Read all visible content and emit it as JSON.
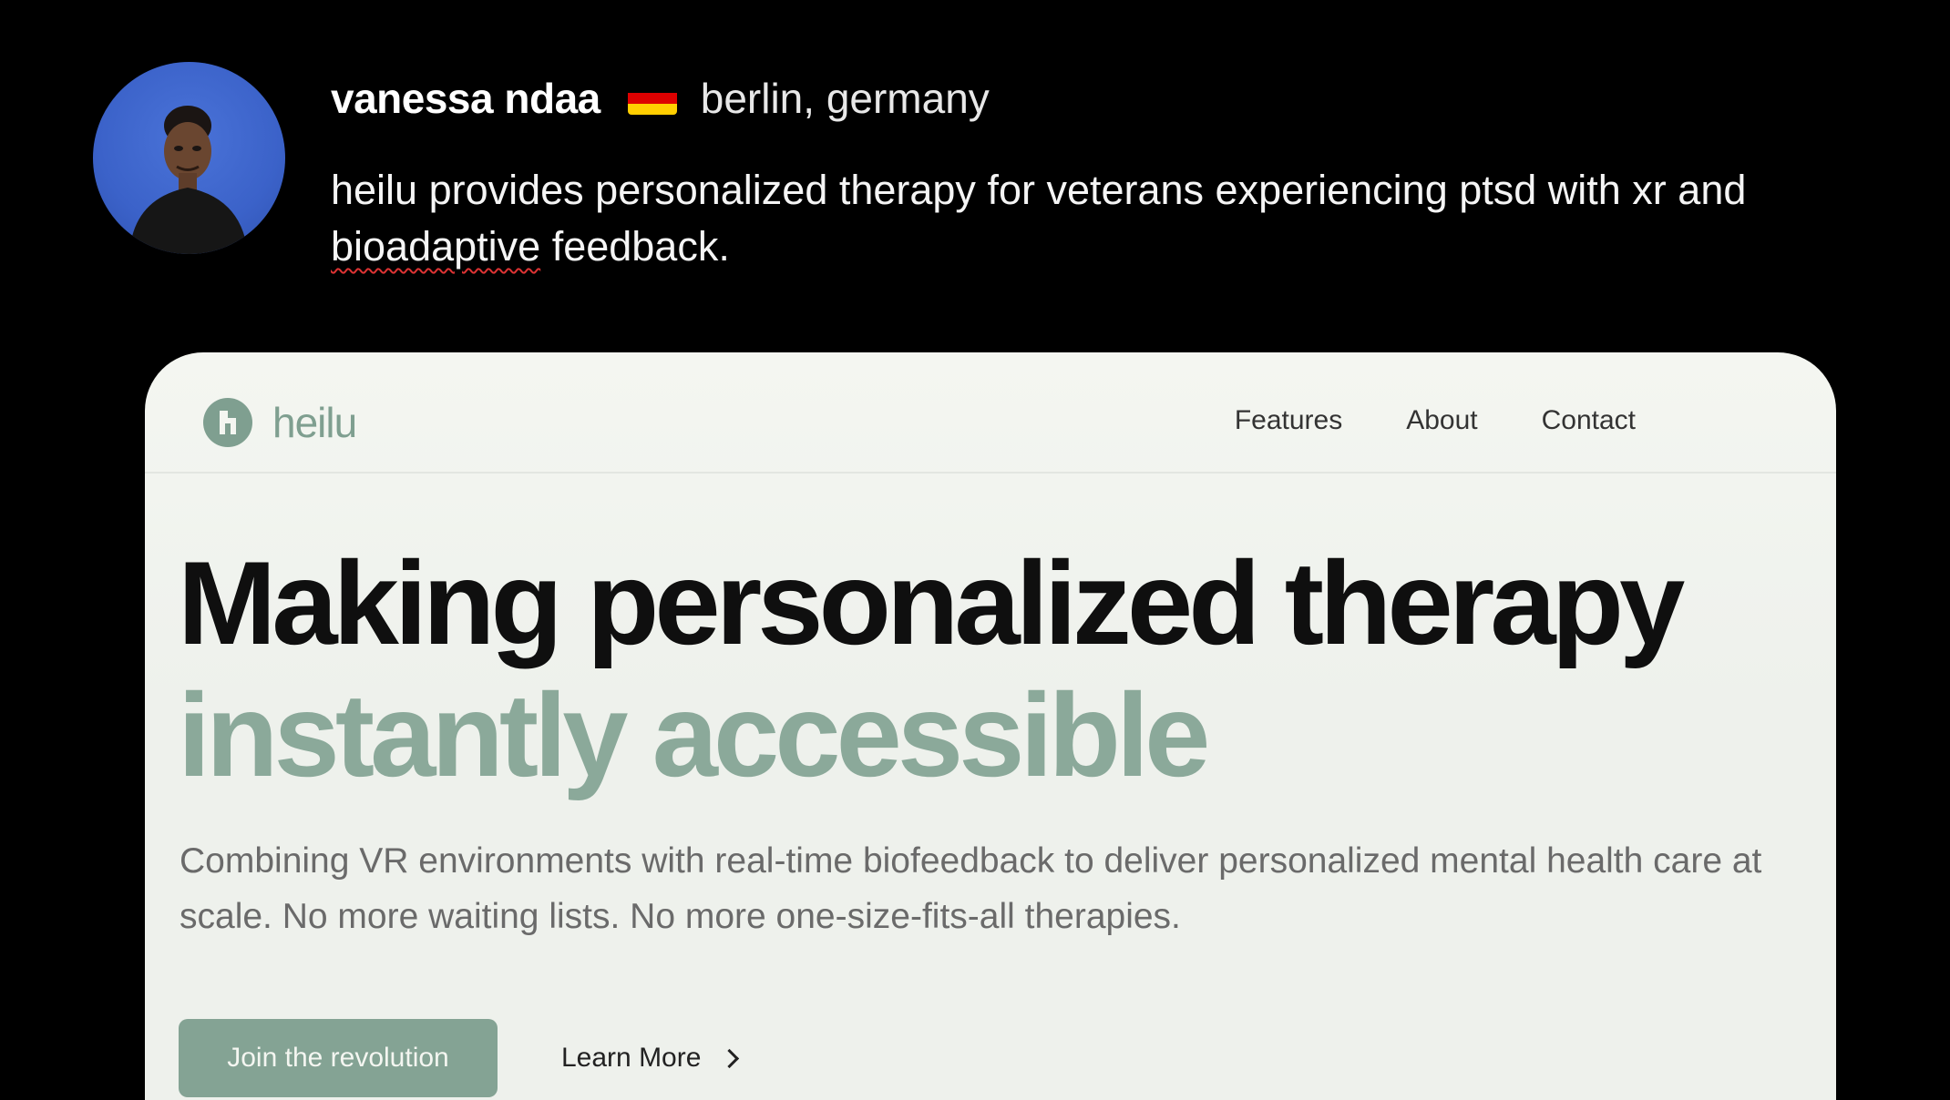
{
  "author": {
    "name": "vanessa ndaa",
    "flag_icon": "germany-flag-icon",
    "location": "berlin, germany"
  },
  "bio": {
    "part1": "heilu provides personalized therapy for veterans experiencing ptsd with xr and ",
    "flagged_word": "bioadaptive",
    "part2": " feedback."
  },
  "site": {
    "logo_text": "heilu",
    "nav": [
      "Features",
      "About",
      "Contact"
    ],
    "hero": {
      "line1": "Making personalized therapy",
      "line2": "instantly accessible",
      "description": "Combining VR environments with real-time biofeedback to deliver personalized mental health care at scale. No more waiting lists. No more one-size-fits-all therapies."
    },
    "primary_button": "Join the revolution",
    "secondary_button": "Learn More"
  },
  "colors": {
    "background": "#000000",
    "card_bg": "#f4f6f1",
    "accent_green": "#84a394",
    "heading": "#0f0f0f",
    "flag_black": "#000000",
    "flag_red": "#dd0000",
    "flag_gold": "#ffce00"
  }
}
